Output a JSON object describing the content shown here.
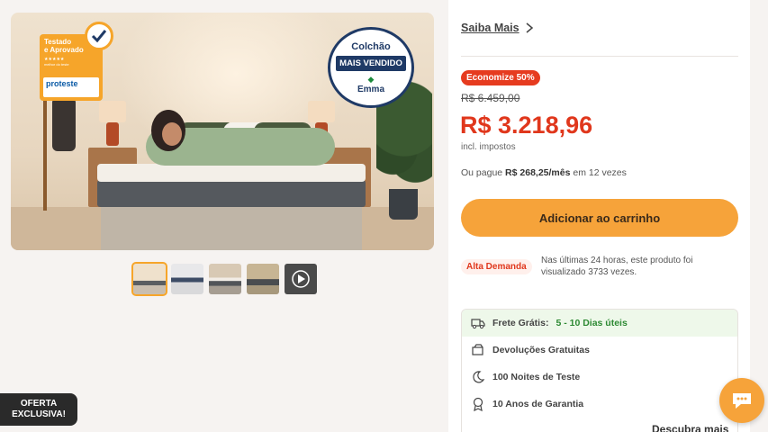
{
  "gallery": {
    "badge_tested": {
      "line1": "Testado",
      "line2": "e Aprovado",
      "stars": "★★★★★",
      "sub": "melhor do teste",
      "brand": "proteste"
    },
    "badge_seal": {
      "top": "Colchão",
      "middle": "MAIS VENDIDO",
      "bottom": "Emma"
    },
    "thumbnails": [
      "thumb-1",
      "thumb-2",
      "thumb-3",
      "thumb-4",
      "thumb-video"
    ]
  },
  "offer_tab": {
    "line1": "OFERTA",
    "line2": "EXCLUSIVA!"
  },
  "product": {
    "saiba_mais": "Saiba Mais",
    "discount_badge": "Economize 50%",
    "old_price": "R$ 6.459,00",
    "price": "R$ 3.218,96",
    "tax_note": "incl. impostos",
    "installment_prefix": "Ou pague",
    "installment_value": "R$ 268,25/mês",
    "installment_suffix": "em 12 vezes",
    "add_to_cart": "Adicionar ao carrinho",
    "demand_badge": "Alta Demanda",
    "demand_text": "Nas últimas 24 horas, este produto foi visualizado 3733 vezes."
  },
  "benefits": [
    {
      "label": "Frete Grátis:",
      "extra": "5 - 10 Dias úteis",
      "icon": "truck-icon"
    },
    {
      "label": "Devoluções Gratuitas",
      "extra": "",
      "icon": "return-icon"
    },
    {
      "label": "100 Noites de Teste",
      "extra": "",
      "icon": "moon-icon"
    },
    {
      "label": "10 Anos de Garantia",
      "extra": "",
      "icon": "award-icon"
    }
  ],
  "descubra": "Descubra mais",
  "colors": {
    "accent": "#f6a33a",
    "price": "#e0371c"
  }
}
